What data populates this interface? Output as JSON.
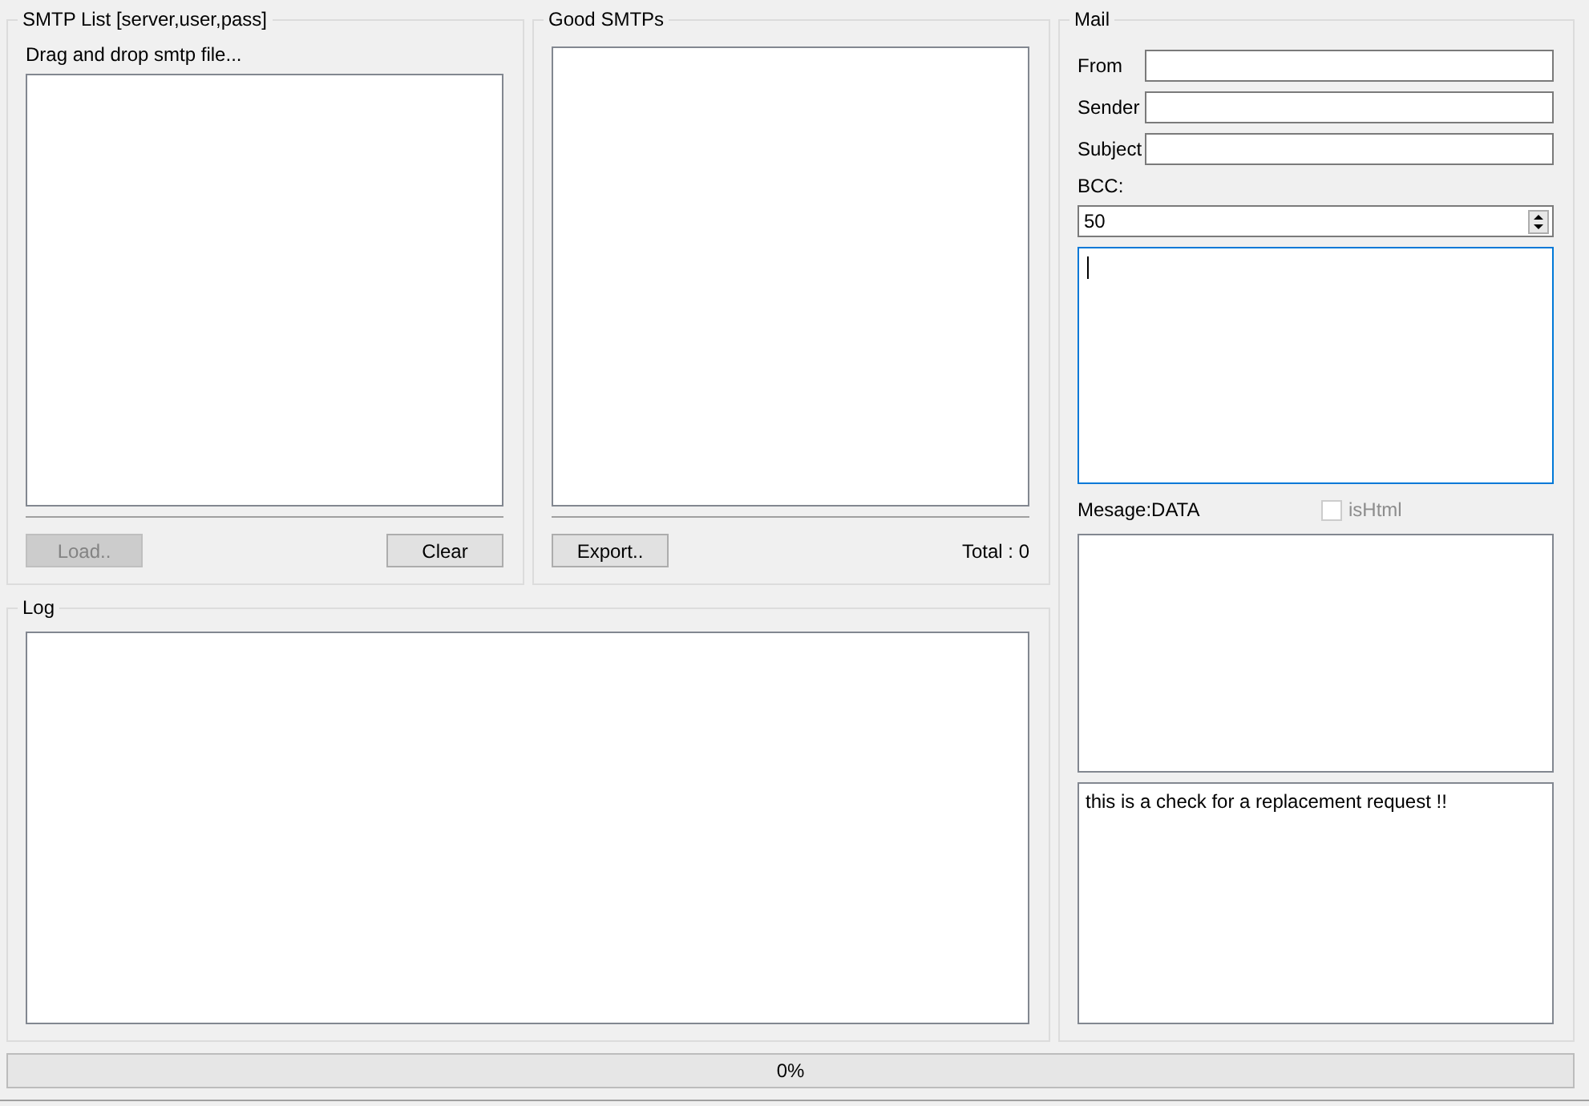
{
  "smtp_list": {
    "title": "SMTP List [server,user,pass]",
    "hint": "Drag and drop smtp file...",
    "buttons": [
      {
        "label": "Load..",
        "disabled": true
      },
      {
        "label": "Clear",
        "disabled": false
      }
    ]
  },
  "good_smtps": {
    "title": "Good SMTPs",
    "button": "Export..",
    "total": "Total : 0"
  },
  "log": {
    "title": "Log"
  },
  "mail": {
    "title": "Mail",
    "fields": [
      {
        "label": "From"
      },
      {
        "label": "Sender"
      },
      {
        "label": "Subject"
      }
    ],
    "bcc": {
      "label": "BCC:",
      "value": "50"
    },
    "list_box": {
      "focused": true
    },
    "message_label": "Mesage:DATA",
    "is_html": {
      "label": "isHtml",
      "checked": false,
      "disabled": true
    },
    "body": "this is a check for a replacement request !!"
  },
  "progress": {
    "level": 0,
    "text": "0%"
  }
}
